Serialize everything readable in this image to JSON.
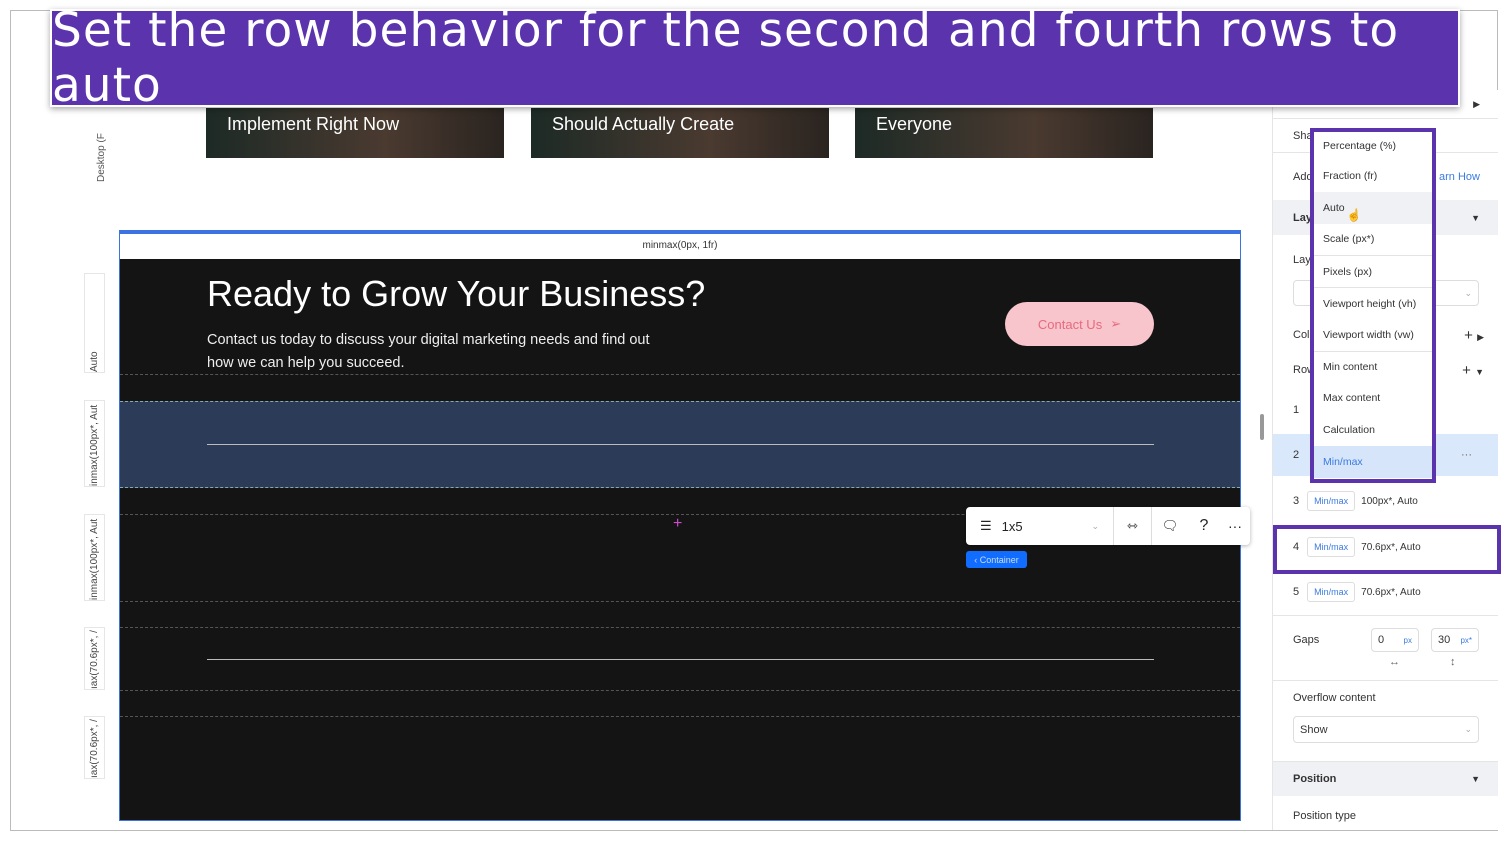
{
  "banner": {
    "text": "Set the row behavior for the second and fourth rows to auto",
    "color": "#5b34ad"
  },
  "cards": [
    "Implement Right Now",
    "Should Actually Create",
    "Everyone"
  ],
  "canvas": {
    "device_label": "Desktop (F",
    "ruler": [
      "Auto",
      "inmax(100px*, Aut",
      "inmax(100px*, Aut",
      "ıax(70.6px*, /",
      "ıax(70.6px*, /"
    ],
    "column_header": "minmax(0px, 1fr)"
  },
  "section": {
    "title": "Ready to Grow Your Business?",
    "description": "Contact us today to discuss your digital marketing needs and find out how we can help you succeed.",
    "contact_button": "Contact Us"
  },
  "toolbar": {
    "layout": "1x5",
    "help": "?",
    "more": "···",
    "breadcrumb": "‹ Container"
  },
  "panel": {
    "partial_labels": [
      "Sha",
      "Add",
      "Lay",
      "Lay",
      "Col",
      "Row"
    ],
    "learn_how": "arn How",
    "rows": [
      {
        "num": "1",
        "type": "",
        "value": ""
      },
      {
        "num": "2",
        "type": "",
        "value": ""
      },
      {
        "num": "3",
        "type": "Min/max",
        "value": "100px*, Auto"
      },
      {
        "num": "4",
        "type": "Min/max",
        "value": "70.6px*, Auto"
      },
      {
        "num": "5",
        "type": "Min/max",
        "value": "70.6px*, Auto"
      }
    ],
    "gaps": {
      "label": "Gaps",
      "h_value": "0",
      "h_unit": "px",
      "v_value": "30",
      "v_unit": "px*"
    },
    "overflow": {
      "label": "Overflow content",
      "value": "Show"
    },
    "position": {
      "label": "Position",
      "type_label": "Position type"
    }
  },
  "dropdown": {
    "options": [
      "Percentage (%)",
      "Fraction (fr)",
      "Auto",
      "Scale (px*)",
      "Pixels (px)",
      "Viewport height (vh)",
      "Viewport width (vw)",
      "Min content",
      "Max content",
      "Calculation",
      "Min/max"
    ],
    "hovered": "Auto",
    "selected": "Min/max"
  }
}
